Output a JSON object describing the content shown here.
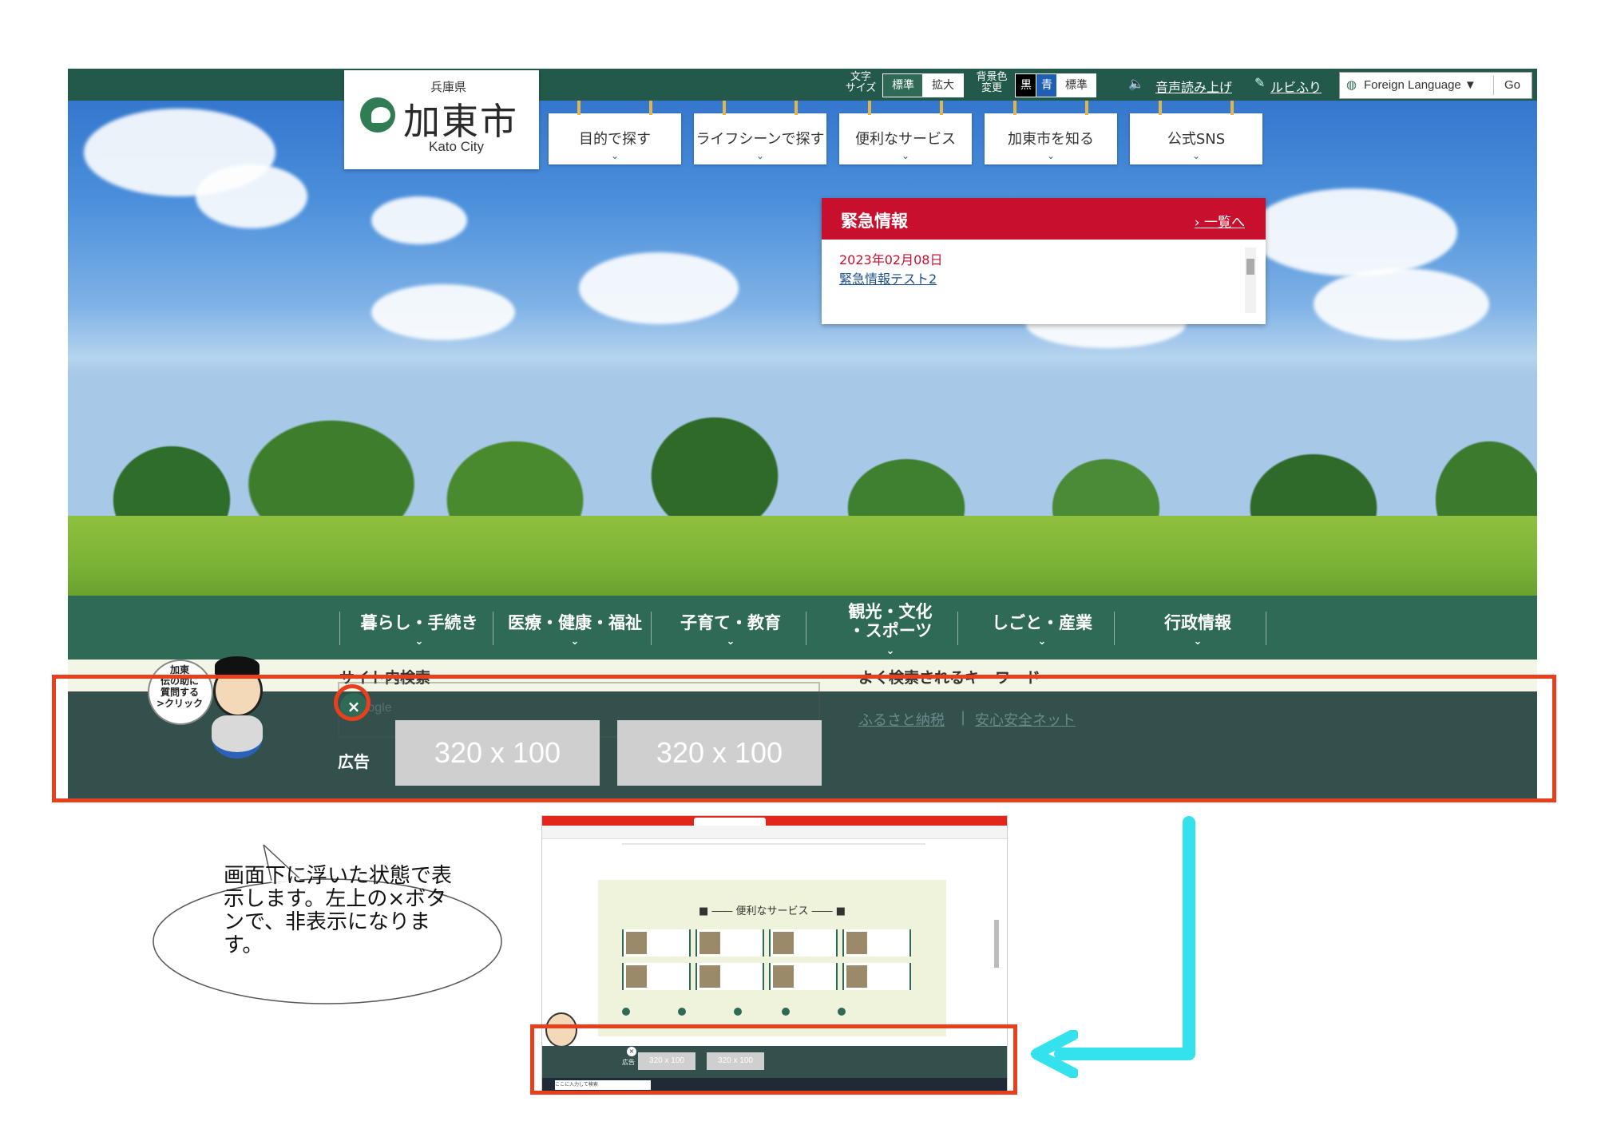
{
  "header": {
    "pref": "兵庫県",
    "city": "加東市",
    "city_en": "Kato City",
    "font_size_label": "文字\nサイズ",
    "font_standard": "標準",
    "font_large": "拡大",
    "bg_label": "背景色\n変更",
    "bg_black": "黒",
    "bg_blue": "青",
    "bg_standard": "標準",
    "read_aloud": "音声読み上げ",
    "ruby": "ルビふり",
    "foreign_language": "Foreign Language ▼",
    "go": "Go"
  },
  "top_menu": [
    "目的で探す",
    "ライフシーンで探す",
    "便利なサービス",
    "加東市を知る",
    "公式SNS"
  ],
  "emergency": {
    "title": "緊急情報",
    "list_link": "› 一覧へ",
    "date": "2023年02月08日",
    "item": "緊急情報テスト2"
  },
  "main_nav": [
    "暮らし・手続き",
    "医療・健康・福祉",
    "子育て・教育",
    "観光・文化\n・スポーツ",
    "しごと・産業",
    "行政情報"
  ],
  "mascot": {
    "label": "加東\n伝の助に\n質問する\n>クリック"
  },
  "search": {
    "site_search": "サイト内検索",
    "keywords": "よく検索されるキーワード",
    "keyword1": "ふるさと納税",
    "keyword2": "安心安全ネット",
    "google": "Google"
  },
  "ad_bar": {
    "label": "広告",
    "ad1": "320 x 100",
    "ad2": "320 x 100",
    "close": "×"
  },
  "callout": {
    "text": "画面下に浮いた状態で表示します。左上の×ボタンで、非表示になります。"
  },
  "mini_screenshot": {
    "panel_title": "■ ―― 便利なサービス ―― ■",
    "ad_label": "広告",
    "ad1": "320 x 100",
    "ad2": "320 x 100",
    "search_placeholder": "ここに入力して検索"
  },
  "colors": {
    "accent_green": "#2e6a55",
    "emergency_red": "#c8102e",
    "highlight": "#e8401c",
    "arrow": "#33e2ec",
    "ad_bar": "#33504d"
  }
}
